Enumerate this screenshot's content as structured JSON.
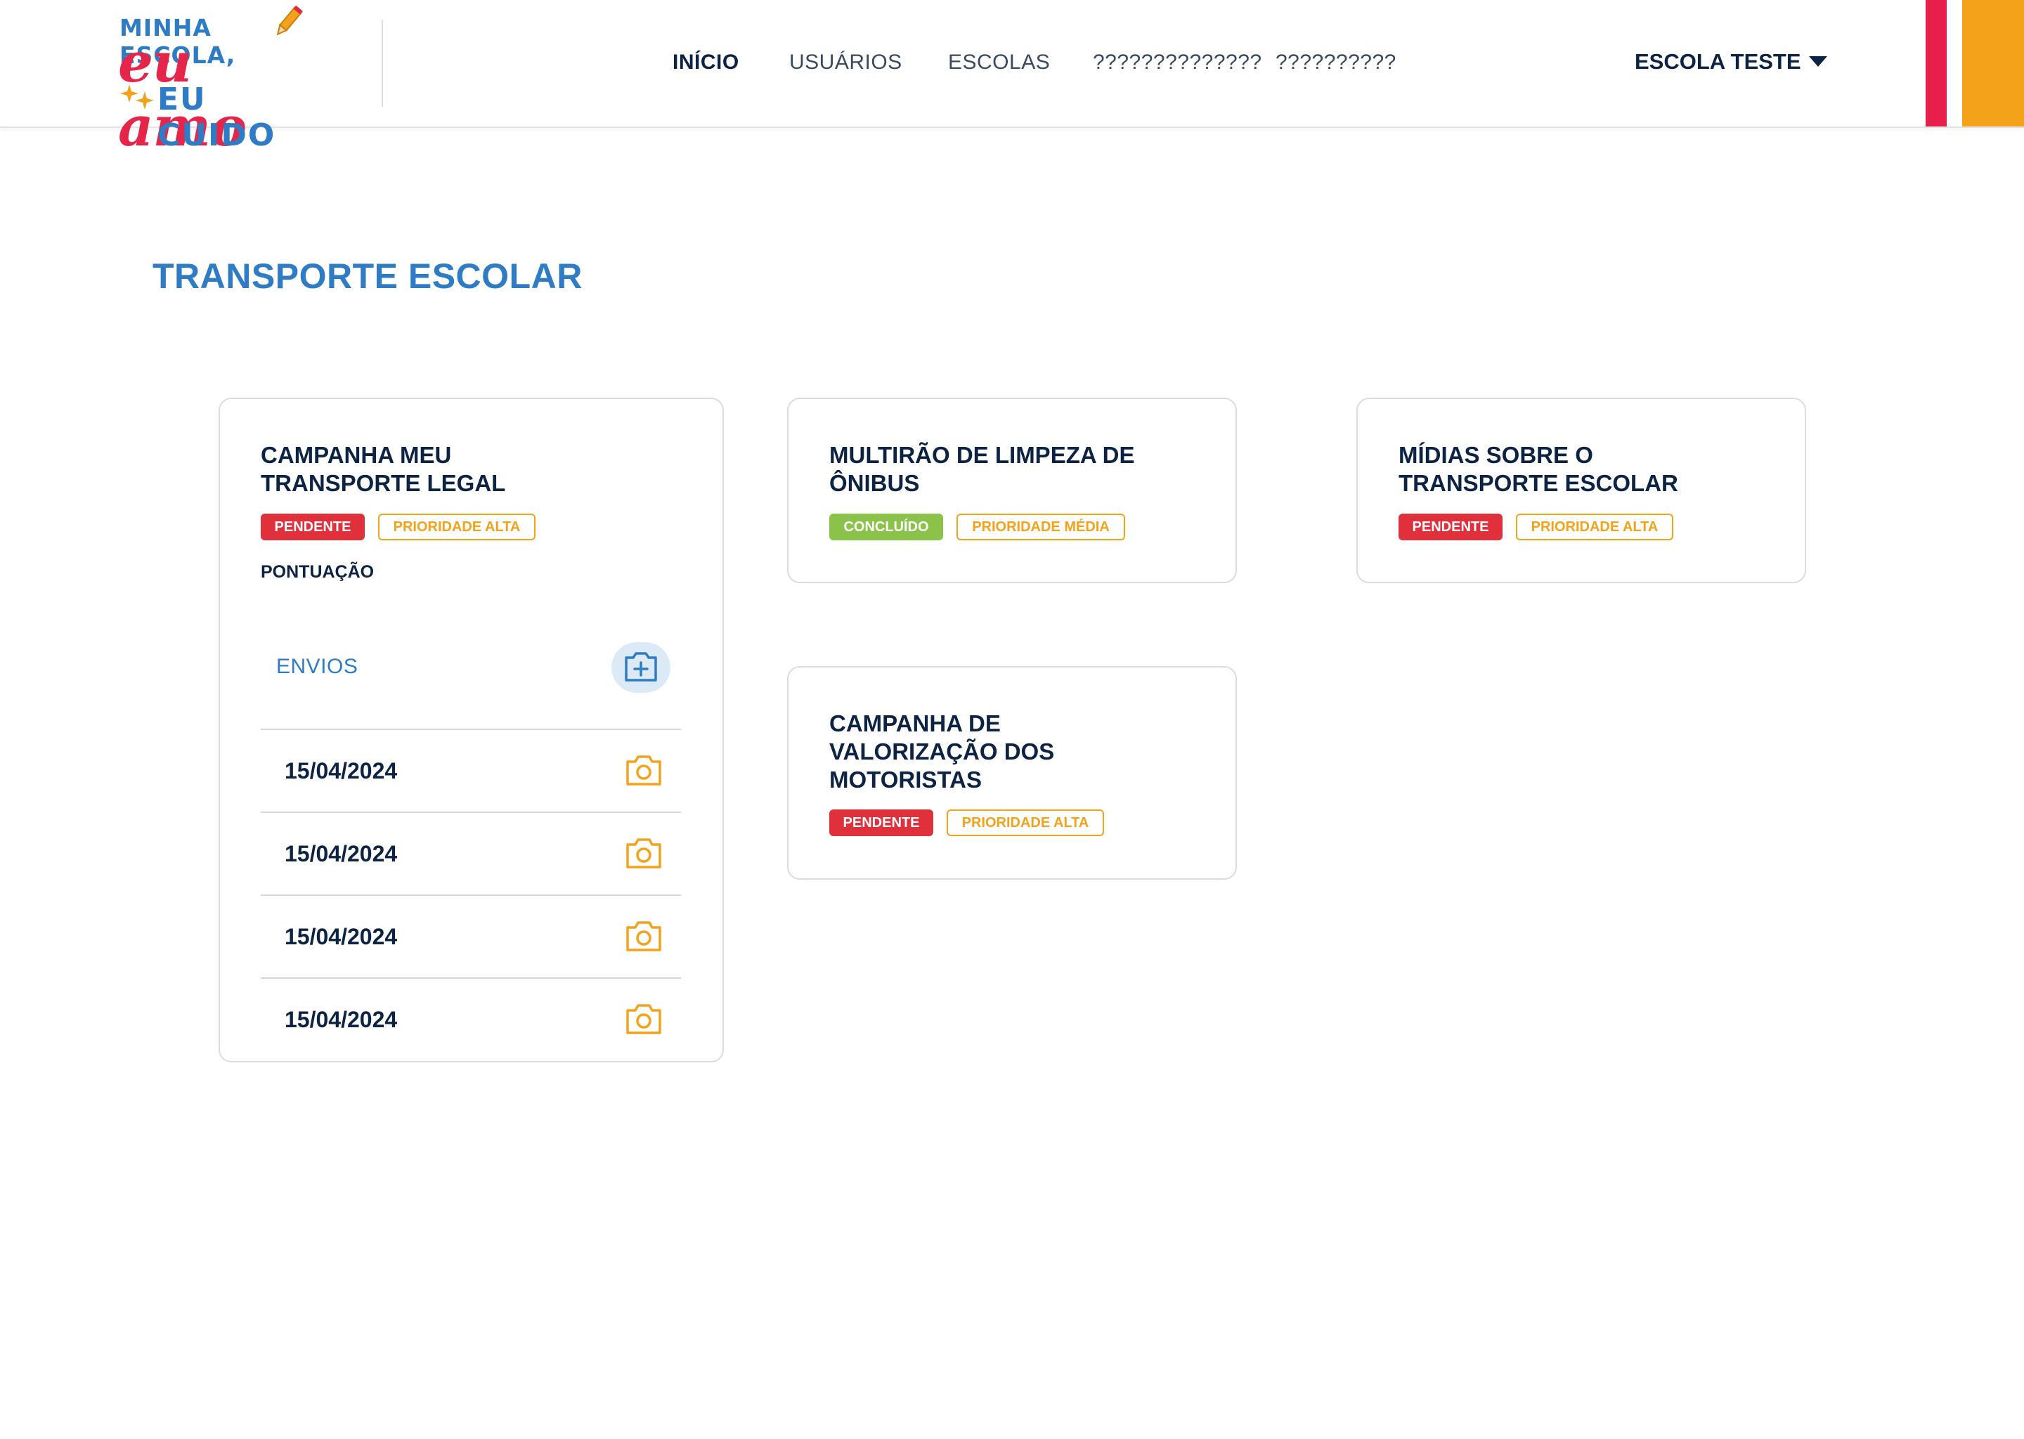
{
  "header": {
    "logo": {
      "line1": "MINHA ESCOLA,",
      "line2": "eu amo",
      "line3": "EU CUIDO"
    },
    "nav": [
      {
        "label": "INÍCIO",
        "active": true
      },
      {
        "label": "USUÁRIOS",
        "active": false
      },
      {
        "label": "ESCOLAS",
        "active": false
      },
      {
        "label": "??????????????",
        "active": false
      },
      {
        "label": "??????????",
        "active": false
      }
    ],
    "school_selector": {
      "label": "ESCOLA TESTE",
      "icon": "caret-down-icon"
    },
    "accent_colors": [
      "#e81f4d",
      "#f5a21b"
    ]
  },
  "page": {
    "title": "TRANSPORTE ESCOLAR"
  },
  "cards": [
    {
      "title_lines": [
        "CAMPANHA MEU",
        "TRANSPORTE LEGAL"
      ],
      "status": "PENDENTE",
      "status_color": "#e0303c",
      "priority": "PRIORIDADE ALTA",
      "score_label": "PONTUAÇÃO",
      "submissions_label": "ENVIOS",
      "add_icon": "add-photo-icon",
      "submissions": [
        {
          "date": "15/04/2024",
          "icon": "camera-icon"
        },
        {
          "date": "15/04/2024",
          "icon": "camera-icon"
        },
        {
          "date": "15/04/2024",
          "icon": "camera-icon"
        },
        {
          "date": "15/04/2024",
          "icon": "camera-icon"
        }
      ]
    },
    {
      "title_lines": [
        "MULTIRÃO DE LIMPEZA DE",
        "ÔNIBUS"
      ],
      "status": "CONCLUÍDO",
      "status_color": "#8bc34a",
      "priority": "PRIORIDADE MÉDIA"
    },
    {
      "title_lines": [
        "MÍDIAS SOBRE O",
        "TRANSPORTE ESCOLAR"
      ],
      "status": "PENDENTE",
      "status_color": "#e0303c",
      "priority": "PRIORIDADE ALTA"
    },
    {
      "title_lines": [
        "CAMPANHA DE",
        "VALORIZAÇÃO DOS",
        "MOTORISTAS"
      ],
      "status": "PENDENTE",
      "status_color": "#e0303c",
      "priority": "PRIORIDADE ALTA"
    }
  ],
  "colors": {
    "brand_blue": "#2f7cc6",
    "brand_red": "#e5264a",
    "brand_orange": "#f5a21b",
    "text_dark": "#0d2344"
  }
}
